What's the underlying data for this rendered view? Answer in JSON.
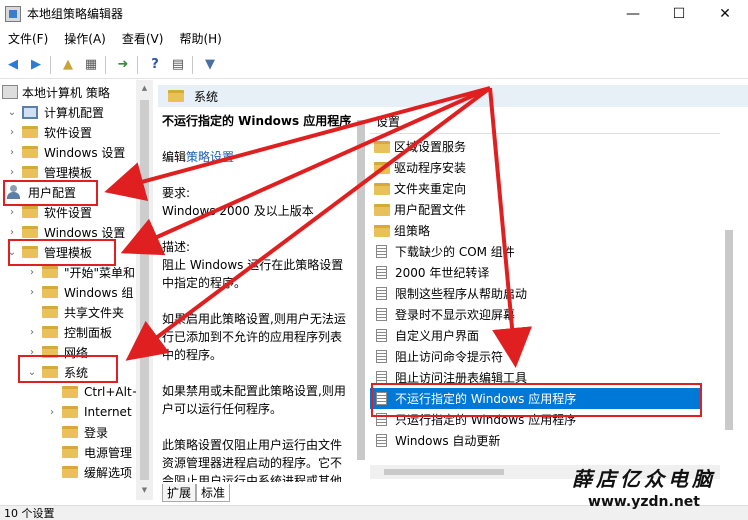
{
  "window": {
    "title": "本地组策略编辑器",
    "minimize": "—",
    "maximize": "☐",
    "close": "✕"
  },
  "menu": [
    {
      "label": "文件(F)"
    },
    {
      "label": "操作(A)"
    },
    {
      "label": "查看(V)"
    },
    {
      "label": "帮助(H)"
    }
  ],
  "tree": {
    "root": "本地计算机 策略",
    "items": [
      {
        "label": "计算机配置",
        "icon": "computer-icon"
      },
      {
        "label": "软件设置",
        "icon": "folder-icon"
      },
      {
        "label": "Windows 设置",
        "icon": "folder-icon"
      },
      {
        "label": "管理模板",
        "icon": "folder-icon"
      },
      {
        "label": "用户配置",
        "icon": "user-icon"
      },
      {
        "label": "软件设置",
        "icon": "folder-icon"
      },
      {
        "label": "Windows 设置",
        "icon": "folder-icon"
      },
      {
        "label": "管理模板",
        "icon": "folder-icon"
      },
      {
        "label": "\"开始\"菜单和",
        "icon": "folder-icon"
      },
      {
        "label": "Windows 组",
        "icon": "folder-icon"
      },
      {
        "label": "共享文件夹",
        "icon": "folder-icon"
      },
      {
        "label": "控制面板",
        "icon": "folder-icon"
      },
      {
        "label": "网络",
        "icon": "folder-icon"
      },
      {
        "label": "系统",
        "icon": "folder-icon"
      },
      {
        "label": "Ctrl+Alt+",
        "icon": "folder-icon"
      },
      {
        "label": "Internet",
        "icon": "folder-icon"
      },
      {
        "label": "登录",
        "icon": "folder-icon"
      },
      {
        "label": "电源管理",
        "icon": "folder-icon"
      },
      {
        "label": "缓解选项",
        "icon": "folder-icon"
      }
    ]
  },
  "content": {
    "folder_title": "系统",
    "policy_title": "不运行指定的 Windows 应用程序",
    "edit_prefix": "编辑",
    "edit_link": "策略设置",
    "requirement_label": "要求:",
    "requirement_value": "Windows 2000 及以上版本",
    "description_label": "描述:",
    "description_text": "阻止 Windows 运行在此策略设置中指定的程序。",
    "para_enabled": "如果启用此策略设置,则用户无法运行已添加到不允许的应用程序列表中的程序。",
    "para_disabled": "如果禁用或未配置此策略设置,则用户可以运行任何程序。",
    "para_note": "此策略设置仅阻止用户运行由文件资源管理器进程启动的程序。它不会阻止用户运行由系统进程或其他进程启动的程序。如任务管理器",
    "list_header": "设置",
    "settings": [
      {
        "label": "区域设置服务",
        "type": "folder"
      },
      {
        "label": "驱动程序安装",
        "type": "folder"
      },
      {
        "label": "文件夹重定向",
        "type": "folder"
      },
      {
        "label": "用户配置文件",
        "type": "folder"
      },
      {
        "label": "组策略",
        "type": "folder"
      },
      {
        "label": "下载缺少的 COM 组件",
        "type": "setting"
      },
      {
        "label": "2000 年世纪转译",
        "type": "setting"
      },
      {
        "label": "限制这些程序从帮助启动",
        "type": "setting"
      },
      {
        "label": "登录时不显示欢迎屏幕",
        "type": "setting"
      },
      {
        "label": "自定义用户界面",
        "type": "setting"
      },
      {
        "label": "阻止访问命令提示符",
        "type": "setting"
      },
      {
        "label": "阻止访问注册表编辑工具",
        "type": "setting"
      },
      {
        "label": "不运行指定的 Windows 应用程序",
        "type": "setting",
        "selected": true
      },
      {
        "label": "只运行指定的 Windows 应用程序",
        "type": "setting"
      },
      {
        "label": "Windows 自动更新",
        "type": "setting"
      }
    ]
  },
  "tabs": [
    {
      "label": "扩展",
      "active": false
    },
    {
      "label": "标准",
      "active": true
    }
  ],
  "status": "10 个设置",
  "watermark": {
    "text": "薛店亿众电脑",
    "url": "www.yzdn.net"
  },
  "colors": {
    "selection": "#0078d7",
    "annotation_red": "#e02020",
    "header_bg": "#e8f0f7"
  }
}
